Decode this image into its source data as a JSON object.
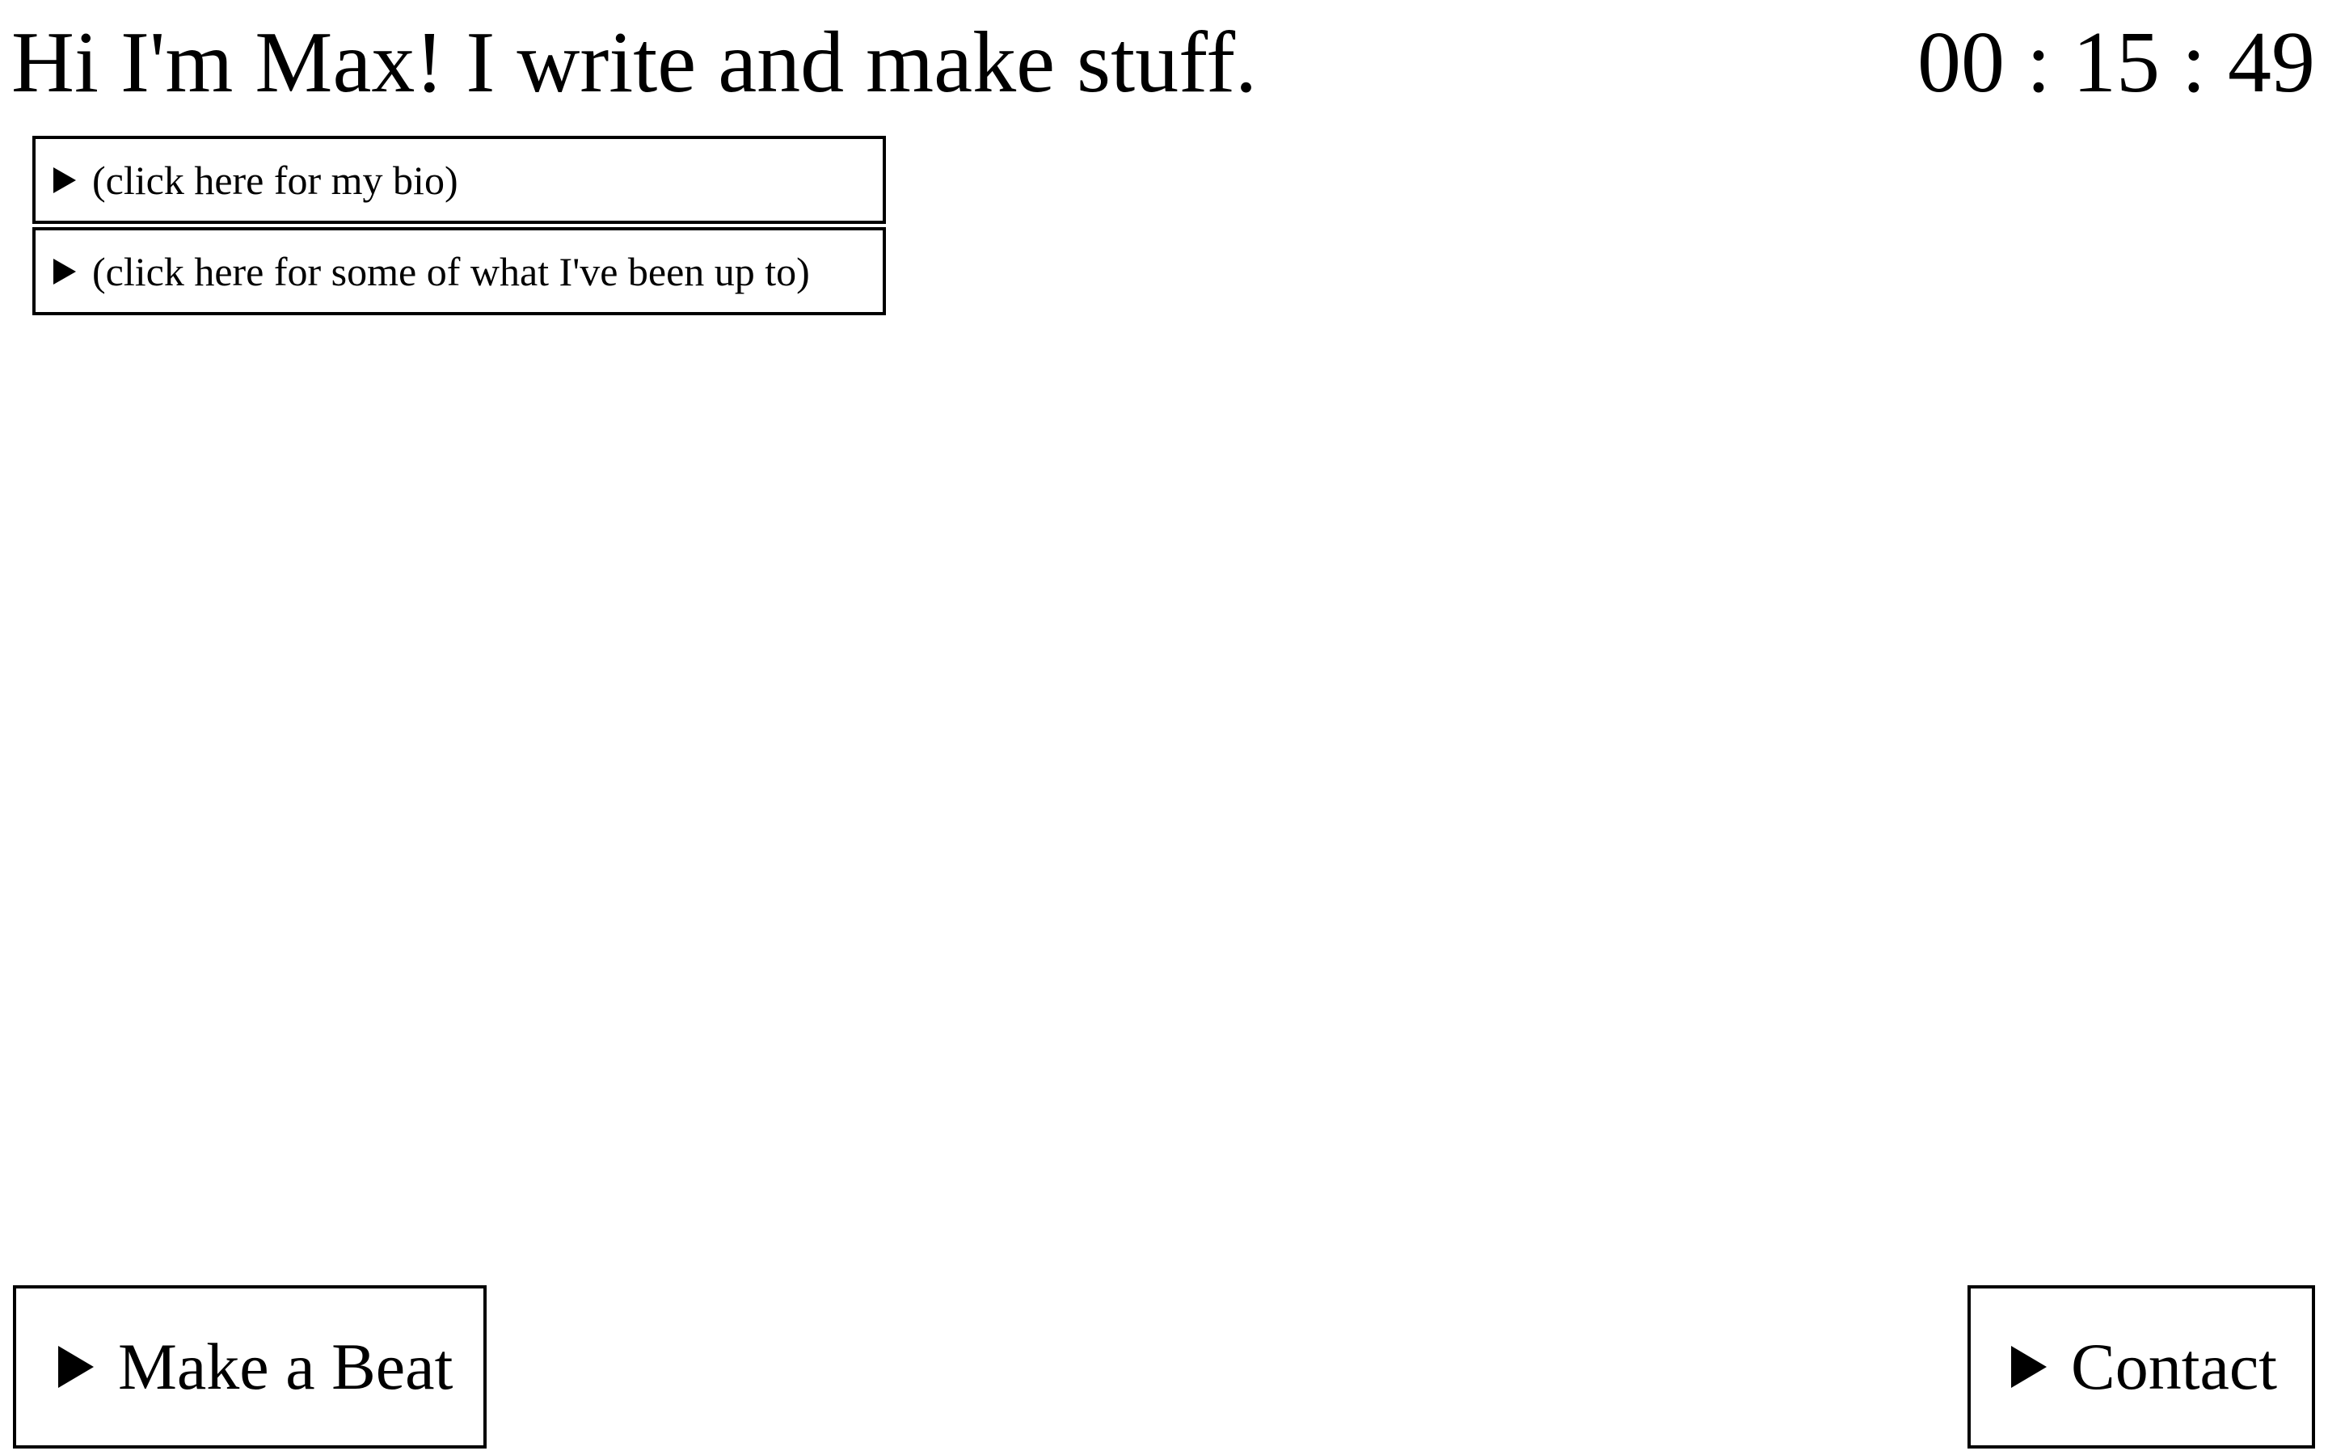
{
  "header": {
    "title": "Hi I'm Max! I write and make stuff.",
    "clock": "00 : 15 : 49"
  },
  "details": [
    {
      "label": "(click here for my bio)",
      "icon": "triangle-right-icon"
    },
    {
      "label": "(click here for some of what I've been up to)",
      "icon": "triangle-right-icon"
    }
  ],
  "footer": {
    "make_beat_label": "Make a Beat",
    "contact_label": "Contact",
    "icon": "triangle-right-icon"
  }
}
